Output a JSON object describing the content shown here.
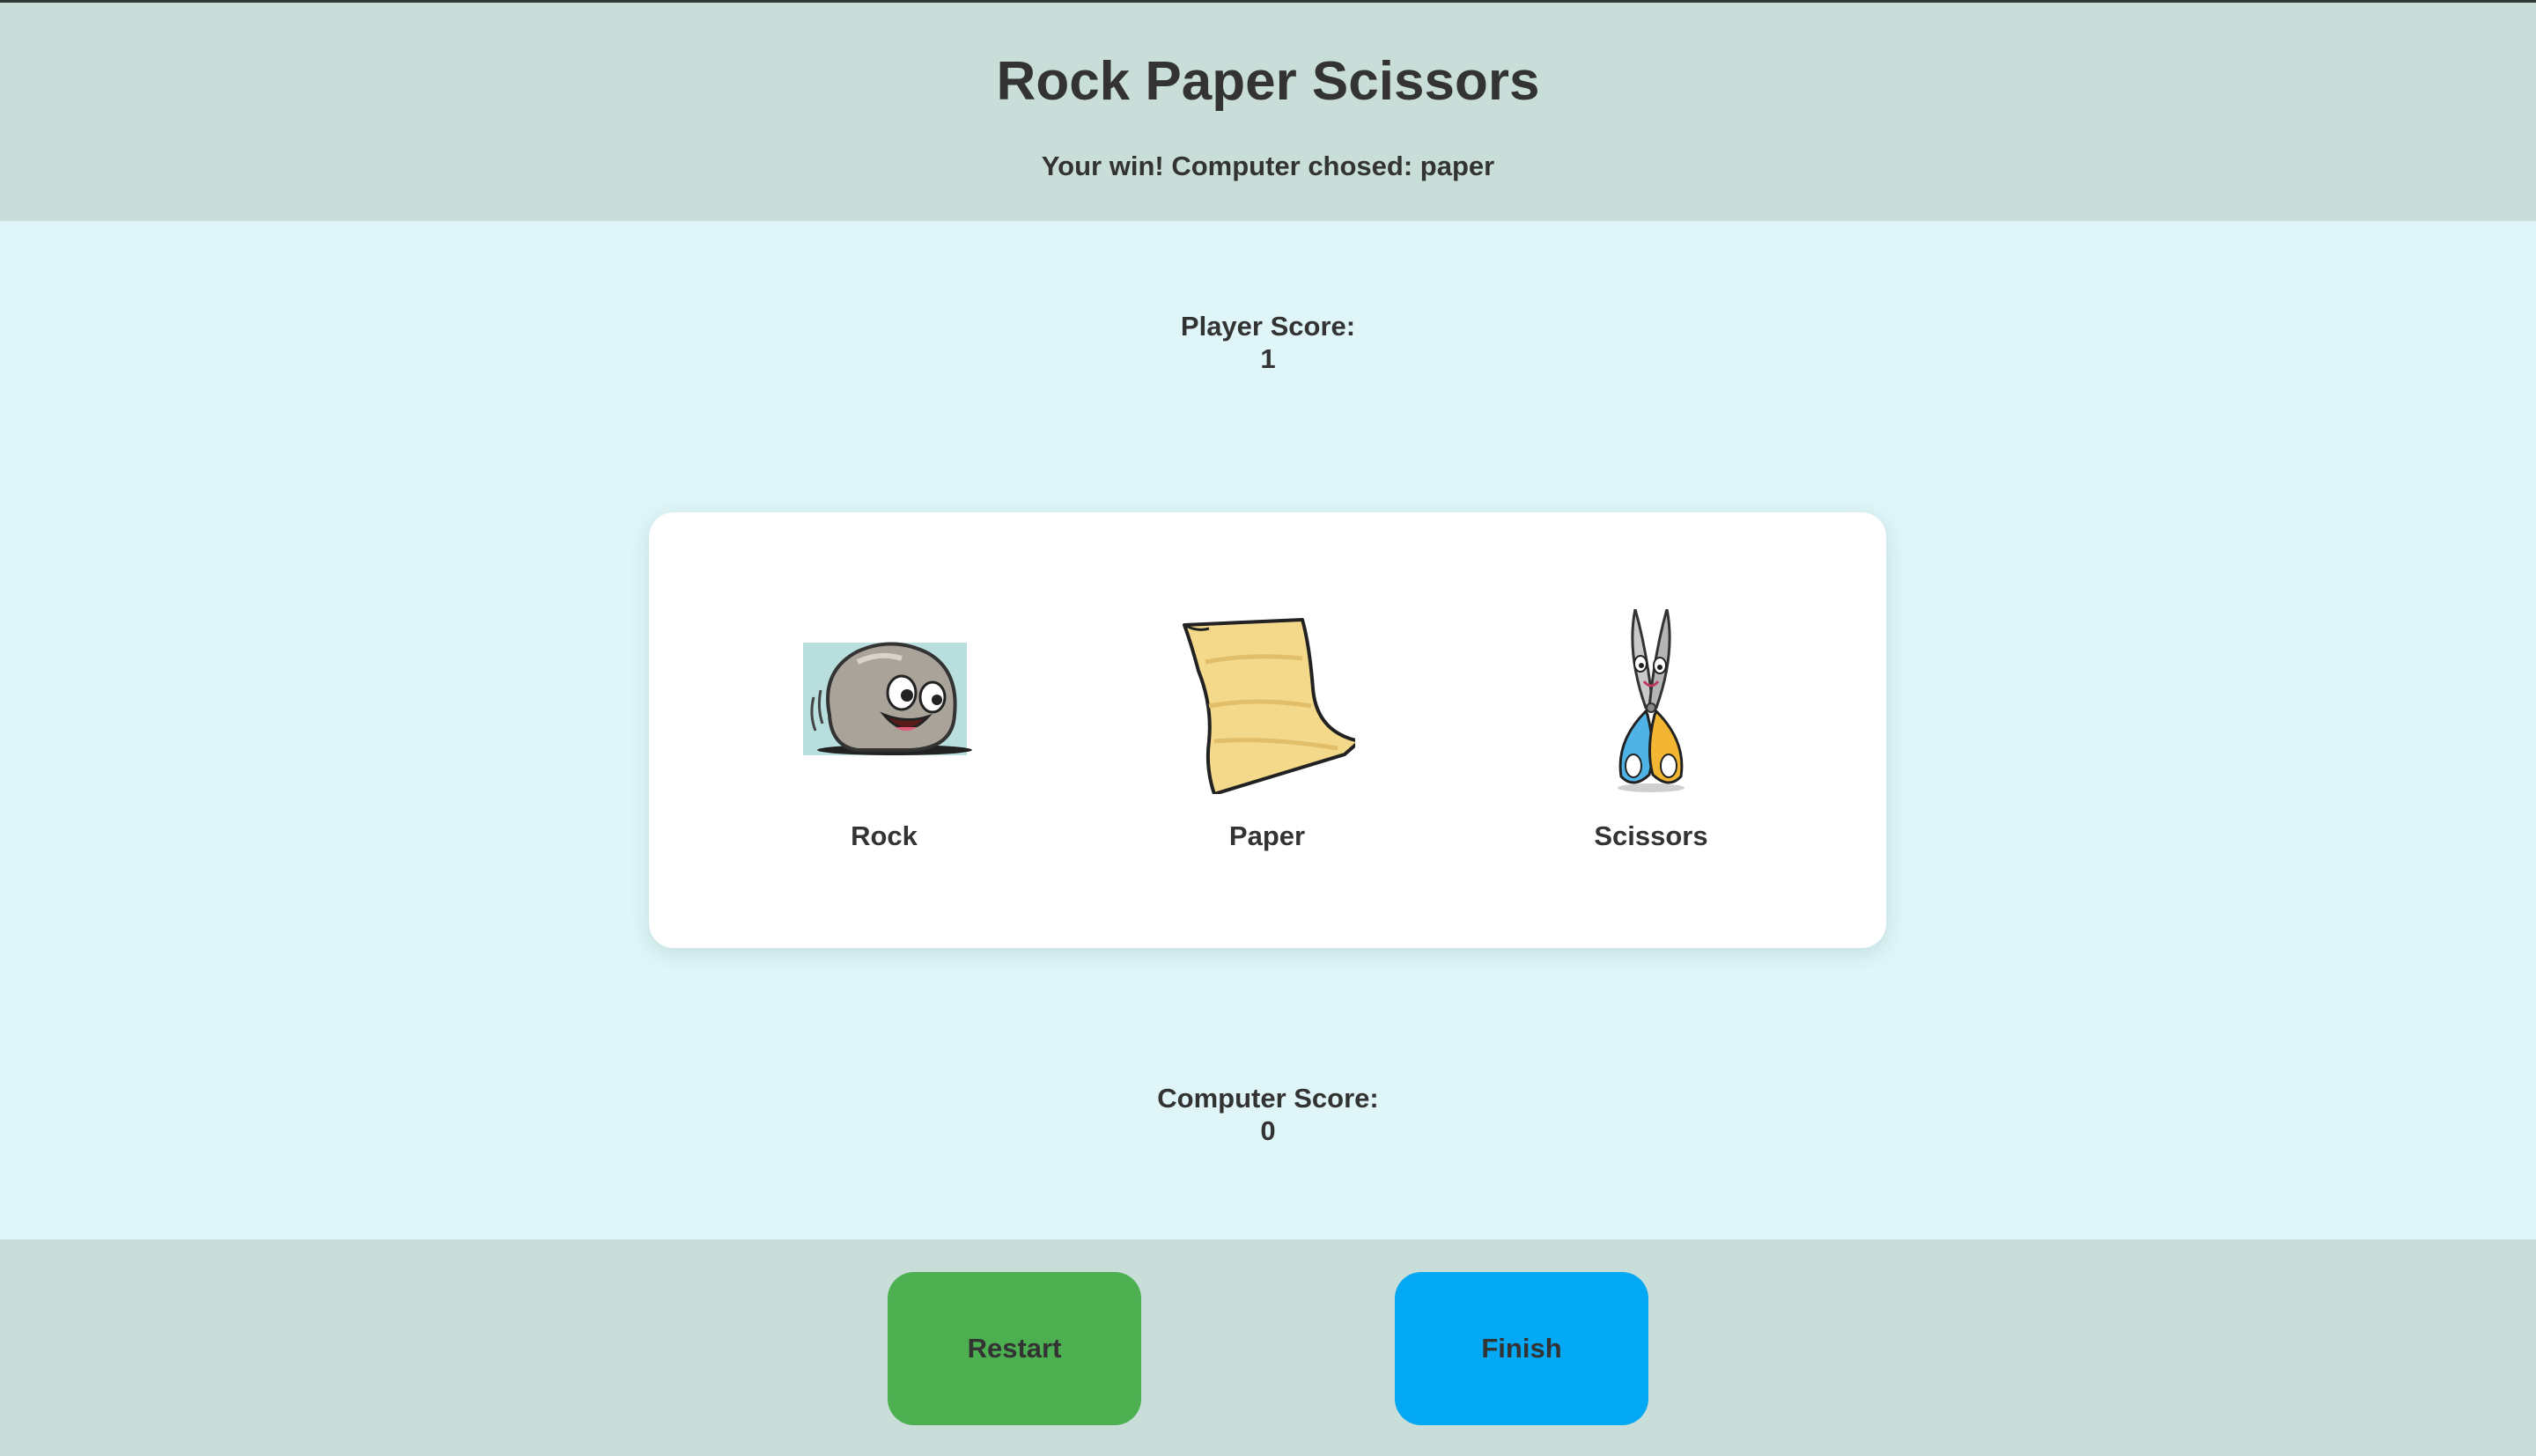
{
  "header": {
    "title": "Rock Paper Scissors",
    "result": "Your win! Computer chosed: paper"
  },
  "scores": {
    "player_label": "Player Score:",
    "player_value": "1",
    "computer_label": "Computer Score:",
    "computer_value": "0"
  },
  "choices": [
    {
      "label": "Rock",
      "icon": "rock-icon"
    },
    {
      "label": "Paper",
      "icon": "paper-icon"
    },
    {
      "label": "Scissors",
      "icon": "scissors-icon"
    }
  ],
  "footer": {
    "restart_label": "Restart",
    "finish_label": "Finish"
  },
  "colors": {
    "header_bg": "#c9ded8",
    "main_bg": "#dff5f7",
    "restart": "#4caf50",
    "finish": "#03a9f4"
  }
}
